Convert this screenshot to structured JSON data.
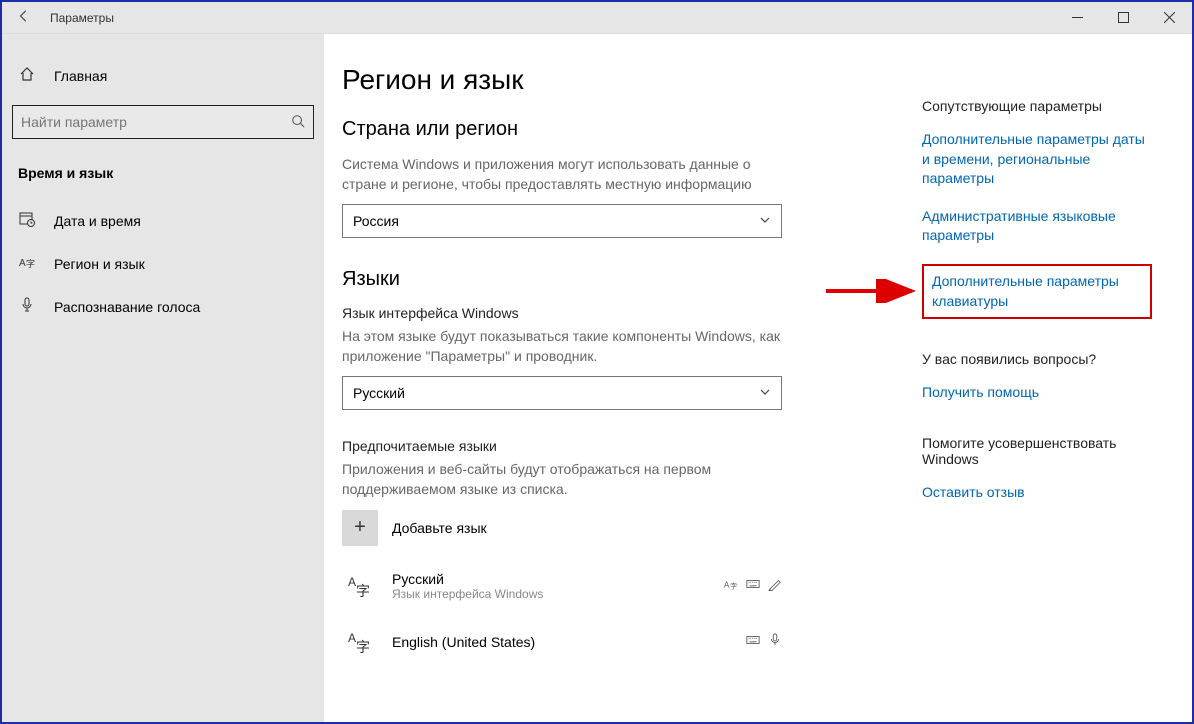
{
  "titlebar": {
    "title": "Параметры"
  },
  "sidebar": {
    "home": "Главная",
    "search_placeholder": "Найти параметр",
    "category": "Время и язык",
    "items": [
      {
        "label": "Дата и время"
      },
      {
        "label": "Регион и язык"
      },
      {
        "label": "Распознавание голоса"
      }
    ]
  },
  "main": {
    "title": "Регион и язык",
    "region": {
      "heading": "Страна или регион",
      "desc": "Система Windows и приложения могут использовать данные о стране и регионе, чтобы предоставлять местную информацию",
      "selected": "Россия"
    },
    "languages": {
      "heading": "Языки",
      "display_label": "Язык интерфейса Windows",
      "display_desc": "На этом языке будут показываться такие компоненты Windows, как приложение \"Параметры\" и проводник.",
      "display_selected": "Русский",
      "preferred_label": "Предпочитаемые языки",
      "preferred_desc": "Приложения и веб-сайты будут отображаться на первом поддерживаемом языке из списка.",
      "add_label": "Добавьте язык",
      "list": [
        {
          "name": "Русский",
          "sub": "Язык интерфейса Windows"
        },
        {
          "name": "English (United States)",
          "sub": ""
        }
      ]
    }
  },
  "right": {
    "related_heading": "Сопутствующие параметры",
    "links": [
      "Дополнительные параметры даты и времени, региональные параметры",
      "Административные языковые параметры",
      "Дополнительные параметры клавиатуры"
    ],
    "questions_heading": "У вас появились вопросы?",
    "help_link": "Получить помощь",
    "improve_heading": "Помогите усовершенствовать Windows",
    "feedback_link": "Оставить отзыв"
  }
}
